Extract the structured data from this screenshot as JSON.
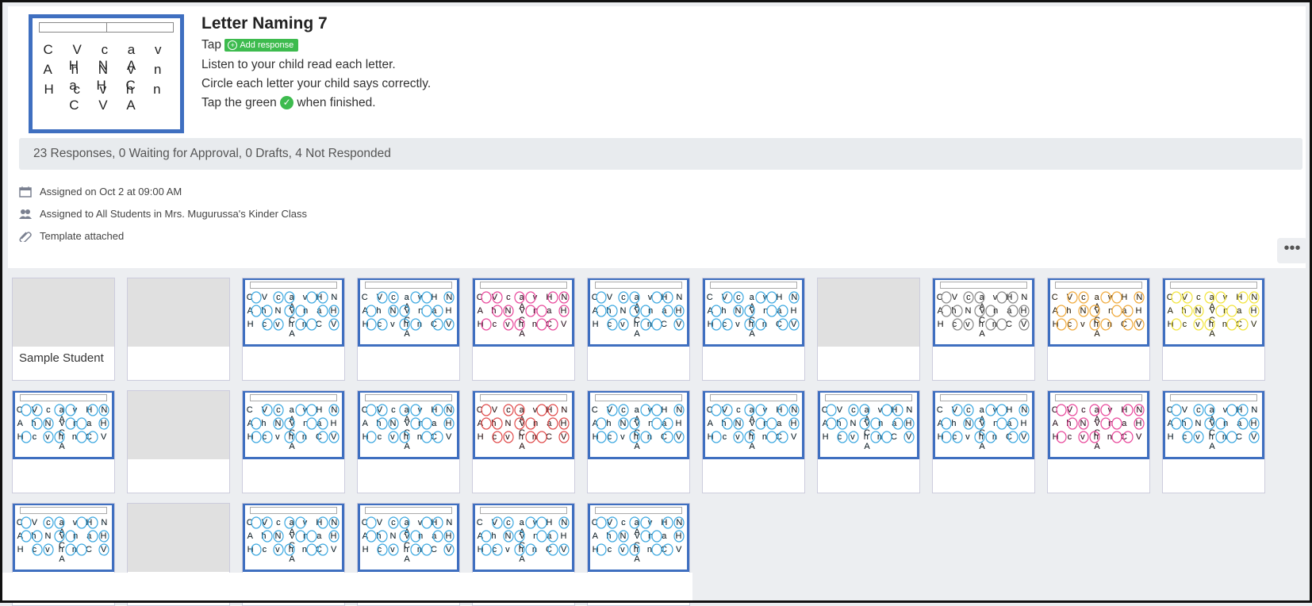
{
  "assignment": {
    "title": "Letter Naming 7",
    "thumbnail_rows": [
      "C V c a v H N A",
      "A h N v n a H C",
      "H c v h n C V A"
    ],
    "instructions": {
      "tap_label": "Tap",
      "add_response_label": "Add response",
      "line_listen": "Listen to your child read each letter.",
      "line_circle": "Circle each letter your child says correctly.",
      "tap_green_prefix": "Tap the green",
      "tap_green_suffix": "when finished."
    }
  },
  "summary": "23 Responses, 0 Waiting for Approval, 0 Drafts, 4 Not Responded",
  "meta": {
    "assigned_on": "Assigned on Oct 2 at 09:00 AM",
    "assigned_to": "Assigned to All Students in Mrs. Mugurussa's Kinder Class",
    "template": "Template attached"
  },
  "more_label": "•••",
  "sample_student_label": "Sample Student",
  "response_rows": [
    "C V c a v H N A",
    "A h N v n a H C",
    "H c v h n C V A"
  ],
  "colors": {
    "accent_blue": "#3f6fc0",
    "green": "#3dbb4e",
    "circle_blue": "#3aa7e0",
    "circle_pink": "#e8469a",
    "circle_red": "#e04a4a",
    "circle_yellow": "#f2e43a",
    "circle_orange": "#f0a93a"
  },
  "icons": {
    "calendar": "calendar-icon",
    "users": "users-icon",
    "paperclip": "paperclip-icon",
    "check": "check-circle-icon",
    "plus": "plus-circle-icon"
  }
}
